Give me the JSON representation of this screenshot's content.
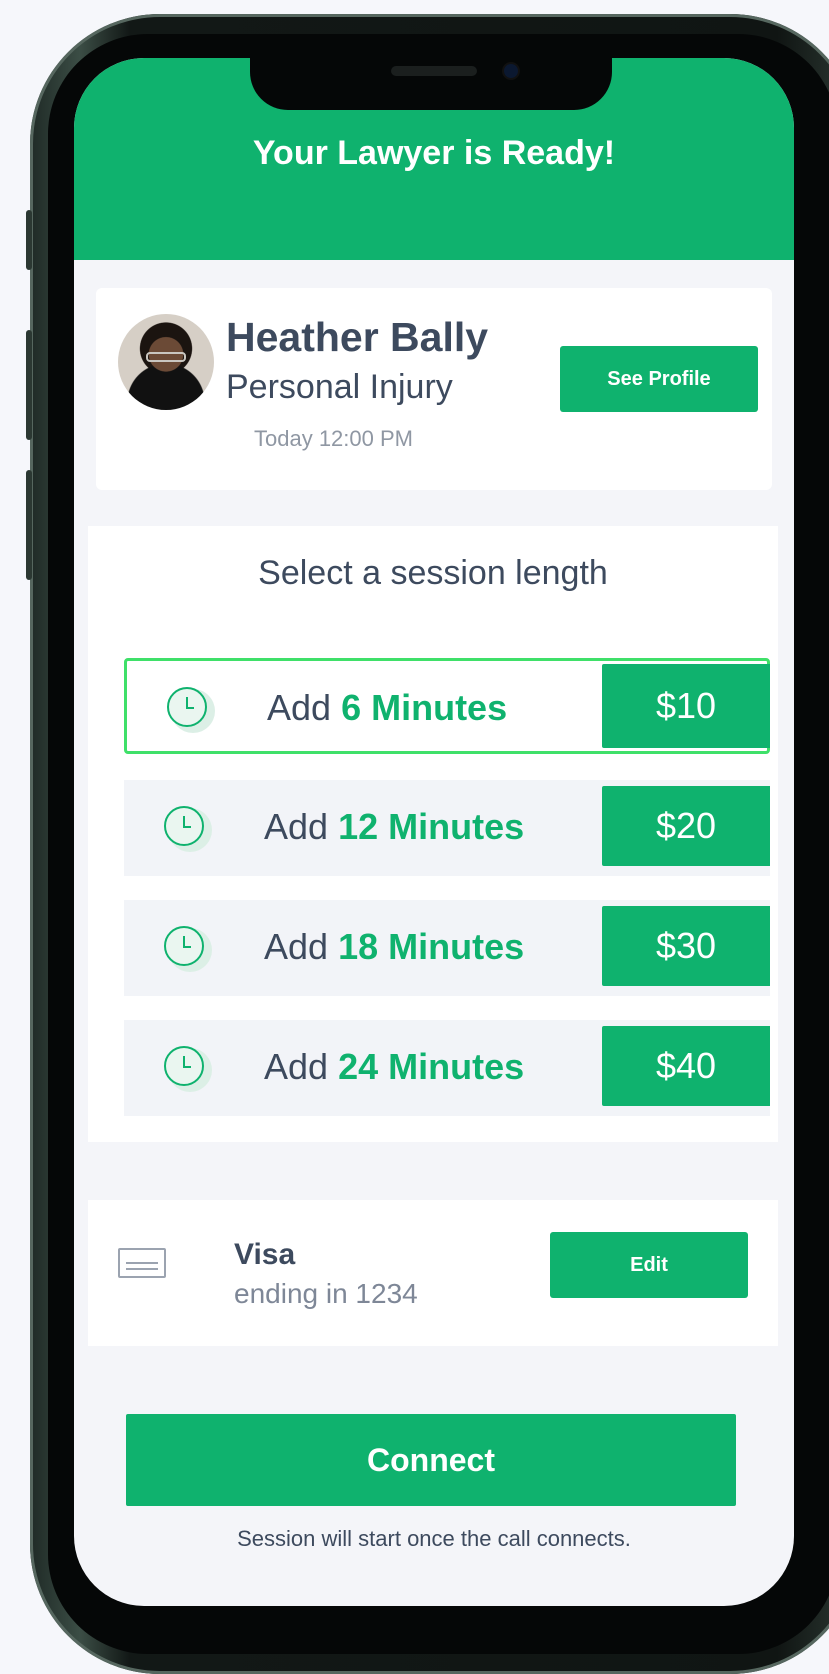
{
  "header": {
    "title": "Your Lawyer is Ready!"
  },
  "lawyer": {
    "name": "Heather Bally",
    "specialty": "Personal Injury",
    "time": "Today 12:00 PM",
    "profile_button": "See Profile"
  },
  "session": {
    "heading": "Select a session length",
    "options": [
      {
        "prefix": "Add",
        "minutes": "6 Minutes",
        "price": "$10",
        "selected": true
      },
      {
        "prefix": "Add",
        "minutes": "12 Minutes",
        "price": "$20",
        "selected": false
      },
      {
        "prefix": "Add",
        "minutes": "18 Minutes",
        "price": "$30",
        "selected": false
      },
      {
        "prefix": "Add",
        "minutes": "24 Minutes",
        "price": "$40",
        "selected": false
      }
    ]
  },
  "payment": {
    "card_brand": "Visa",
    "card_detail": "ending in 1234",
    "edit_button": "Edit"
  },
  "connect_button": "Connect",
  "footnote": "Session will start once the call connects.",
  "colors": {
    "accent": "#0fb26e",
    "selected_border": "#3fe069",
    "text": "#3d4a5e"
  },
  "icons": {
    "session": "clock-icon",
    "payment": "credit-card-icon"
  }
}
